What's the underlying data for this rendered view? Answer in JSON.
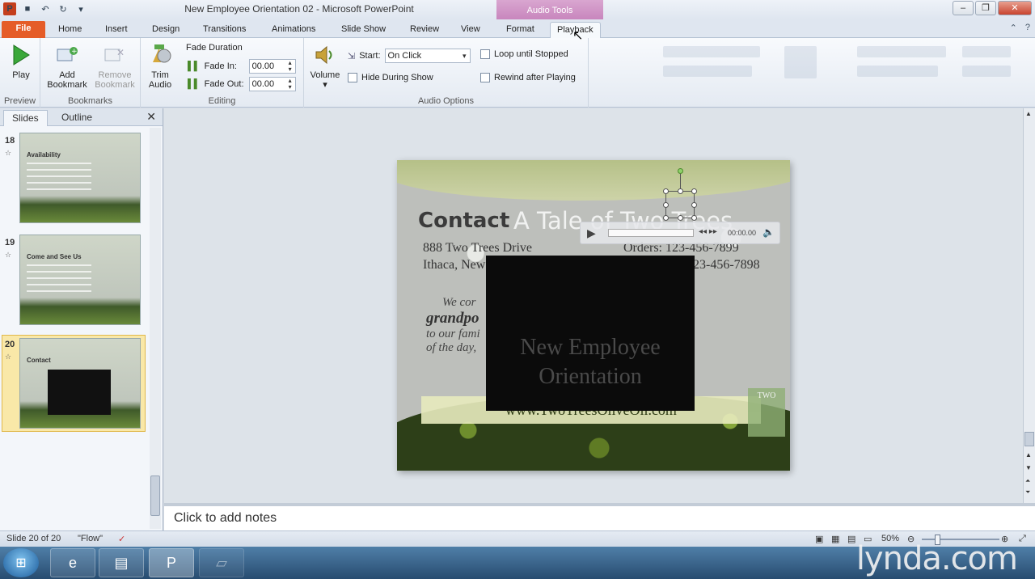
{
  "window": {
    "title": "New Employee Orientation 02 - Microsoft PowerPoint",
    "context_header": "Audio Tools"
  },
  "tabs": [
    {
      "label": "File"
    },
    {
      "label": "Home"
    },
    {
      "label": "Insert"
    },
    {
      "label": "Design"
    },
    {
      "label": "Transitions"
    },
    {
      "label": "Animations"
    },
    {
      "label": "Slide Show"
    },
    {
      "label": "Review"
    },
    {
      "label": "View"
    },
    {
      "label": "Format"
    },
    {
      "label": "Playback"
    }
  ],
  "ribbon": {
    "preview": {
      "label": "Preview",
      "play": "Play"
    },
    "bookmarks": {
      "label": "Bookmarks",
      "add_line1": "Add",
      "add_line2": "Bookmark",
      "remove_line1": "Remove",
      "remove_line2": "Bookmark"
    },
    "editing": {
      "label": "Editing",
      "trim_line1": "Trim",
      "trim_line2": "Audio",
      "fade_duration": "Fade Duration",
      "fade_in_label": "Fade In:",
      "fade_in_value": "00.00",
      "fade_out_label": "Fade Out:",
      "fade_out_value": "00.00"
    },
    "audio_options": {
      "label": "Audio Options",
      "volume": "Volume",
      "start_label": "Start:",
      "start_value": "On Click",
      "hide": "Hide During Show",
      "loop": "Loop until Stopped",
      "rewind": "Rewind after Playing"
    }
  },
  "slides_pane": {
    "tab_slides": "Slides",
    "tab_outline": "Outline",
    "thumbs": [
      {
        "number": "18",
        "title": "Availability"
      },
      {
        "number": "19",
        "title": "Come and See Us"
      },
      {
        "number": "20",
        "title": "Contact"
      }
    ]
  },
  "slide": {
    "heading": "Contact",
    "title_overlay": "A Tale of Two Trees",
    "address_line1": "888 Two Trees Drive",
    "address_line2": "Ithaca, New",
    "phone_line1": "Orders:   123-456-7899",
    "phone_line2": "123-456-7898",
    "body_line1": "We cor                                              any my",
    "body_line2": "grandpo                                        ing back",
    "body_line3": "to our fami                                     e at the end",
    "body_line4": "of the day,                                      er most.",
    "url": "www.TwoTreesOliveOil.com",
    "logo": "TWO",
    "video_text_line1": "New Employee",
    "video_text_line2": "Orientation",
    "audio_time": "00:00.00"
  },
  "notes": {
    "placeholder": "Click to add notes"
  },
  "status": {
    "slide": "Slide 20 of 20",
    "theme": "\"Flow\"",
    "zoom": "50%"
  },
  "watermark": "lynda.com",
  "colors": {
    "file_tab": "#e55c28",
    "context_tab": "#c886bd",
    "selection": "#f9e8a8"
  }
}
